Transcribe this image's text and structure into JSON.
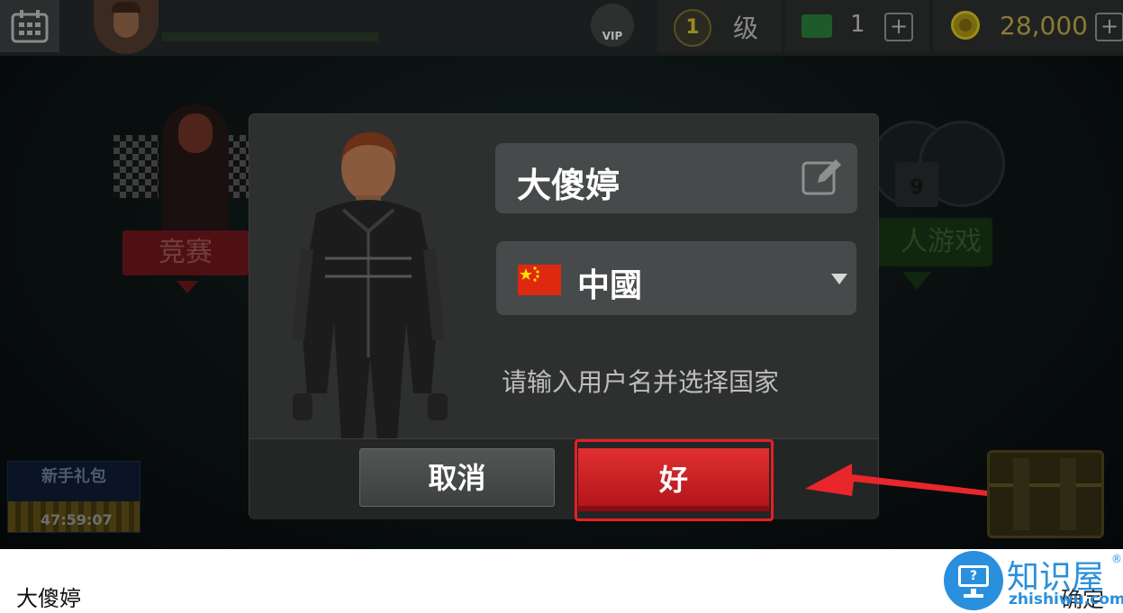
{
  "topbar": {
    "vip_label": "VIP",
    "level_value": "1",
    "level_label": "级",
    "tickets_count": "1",
    "plus_symbol": "+",
    "coins_count": "28,000"
  },
  "menu": {
    "race_label": "竞赛",
    "multiplayer_label": "人游戏",
    "multiplayer_lock_level": "9",
    "starter_pack_title": "新手礼包",
    "starter_pack_timer": "47:59:07"
  },
  "dialog": {
    "username": "大傻婷",
    "country": "中國",
    "hint": "请输入用户名并选择国家",
    "cancel_label": "取消",
    "ok_label": "好"
  },
  "input_bar": {
    "typed_text": "大傻婷",
    "confirm_label": "确定"
  },
  "watermark": {
    "title": "知识屋",
    "registered": "®",
    "subtitle": "zhishiwu.com",
    "icon_glyph": "?"
  },
  "colors": {
    "accent_red": "#e61f25",
    "ok_button": "#c8161d",
    "dialog_bg": "#2e3030",
    "field_bg": "#474a4a",
    "watermark_blue": "#2a8fdc"
  }
}
